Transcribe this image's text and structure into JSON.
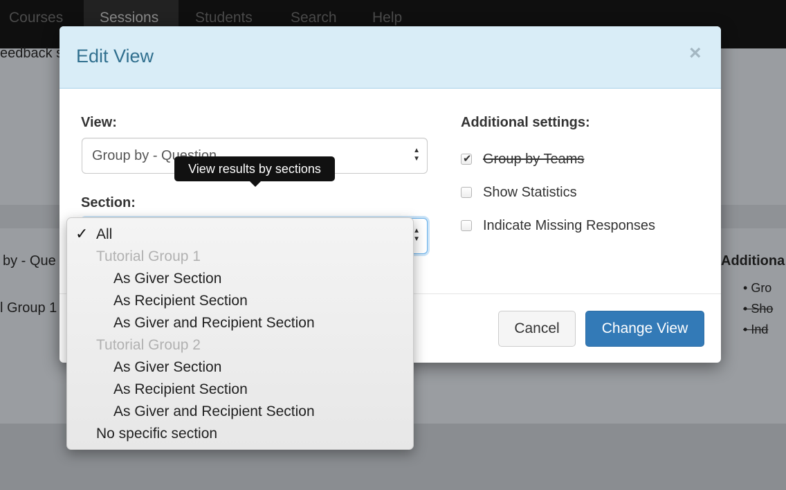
{
  "navbar": {
    "items": [
      {
        "label": "Courses"
      },
      {
        "label": "Sessions"
      },
      {
        "label": "Students"
      },
      {
        "label": "Search"
      },
      {
        "label": "Help"
      }
    ]
  },
  "background": {
    "feedback_fragment": "eedback s",
    "group_by_fragment": "by - Que",
    "group_fragment": "l Group 1",
    "additional_fragment": "Additiona",
    "bullets": [
      "Gro",
      "Sho",
      "Ind"
    ]
  },
  "modal": {
    "title": "Edit View",
    "close_symbol": "×",
    "view_label": "View:",
    "view_value": "Group by - Question",
    "section_label": "Section:",
    "additional_label": "Additional settings:",
    "checkboxes": [
      {
        "label": "Group by Teams",
        "checked": true,
        "strikethrough": true
      },
      {
        "label": "Show Statistics",
        "checked": false,
        "strikethrough": false
      },
      {
        "label": "Indicate Missing Responses",
        "checked": false,
        "strikethrough": false
      }
    ],
    "cancel_label": "Cancel",
    "change_view_label": "Change View"
  },
  "tooltip": {
    "text": "View results by sections"
  },
  "section_dropdown": {
    "selected": "All",
    "options": [
      {
        "label": "All",
        "type": "option"
      },
      {
        "label": "Tutorial Group 1",
        "type": "group"
      },
      {
        "label": "As Giver Section",
        "type": "sub"
      },
      {
        "label": "As Recipient Section",
        "type": "sub"
      },
      {
        "label": "As Giver and Recipient Section",
        "type": "sub"
      },
      {
        "label": "Tutorial Group 2",
        "type": "group"
      },
      {
        "label": "As Giver Section",
        "type": "sub"
      },
      {
        "label": "As Recipient Section",
        "type": "sub"
      },
      {
        "label": "As Giver and Recipient Section",
        "type": "sub"
      },
      {
        "label": "No specific section",
        "type": "option"
      }
    ]
  },
  "icons": {
    "check": "checkmark-icon",
    "close": "close-icon",
    "select_arrows": "updown-arrows-icon"
  }
}
